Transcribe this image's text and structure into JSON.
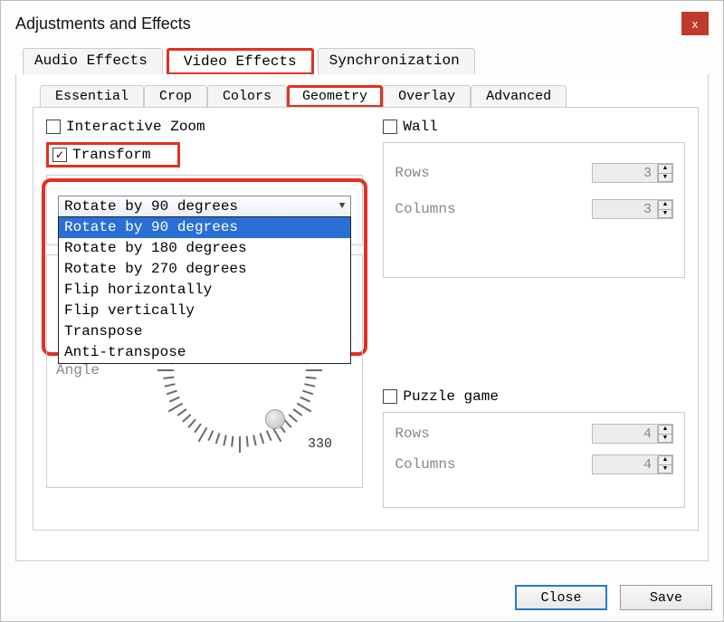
{
  "title": "Adjustments and Effects",
  "close_x": "x",
  "outer_tabs": {
    "audio": "Audio Effects",
    "video": "Video Effects",
    "sync": "Synchronization"
  },
  "inner_tabs": {
    "essential": "Essential",
    "crop": "Crop",
    "colors": "Colors",
    "geometry": "Geometry",
    "overlay": "Overlay",
    "advanced": "Advanced"
  },
  "geometry": {
    "interactive_zoom": "Interactive Zoom",
    "transform": "Transform",
    "transform_value": "Rotate by 90 degrees",
    "transform_options": [
      "Rotate by 90 degrees",
      "Rotate by 180 degrees",
      "Rotate by 270 degrees",
      "Flip horizontally",
      "Flip vertically",
      "Transpose",
      "Anti-transpose"
    ],
    "rotate": {
      "angle_label": "Angle",
      "dial_label_330": "330"
    },
    "wall": {
      "label": "Wall",
      "rows_label": "Rows",
      "rows_value": "3",
      "cols_label": "Columns",
      "cols_value": "3"
    },
    "puzzle": {
      "label": "Puzzle game",
      "rows_label": "Rows",
      "rows_value": "4",
      "cols_label": "Columns",
      "cols_value": "4"
    }
  },
  "footer": {
    "close": "Close",
    "save": "Save"
  }
}
